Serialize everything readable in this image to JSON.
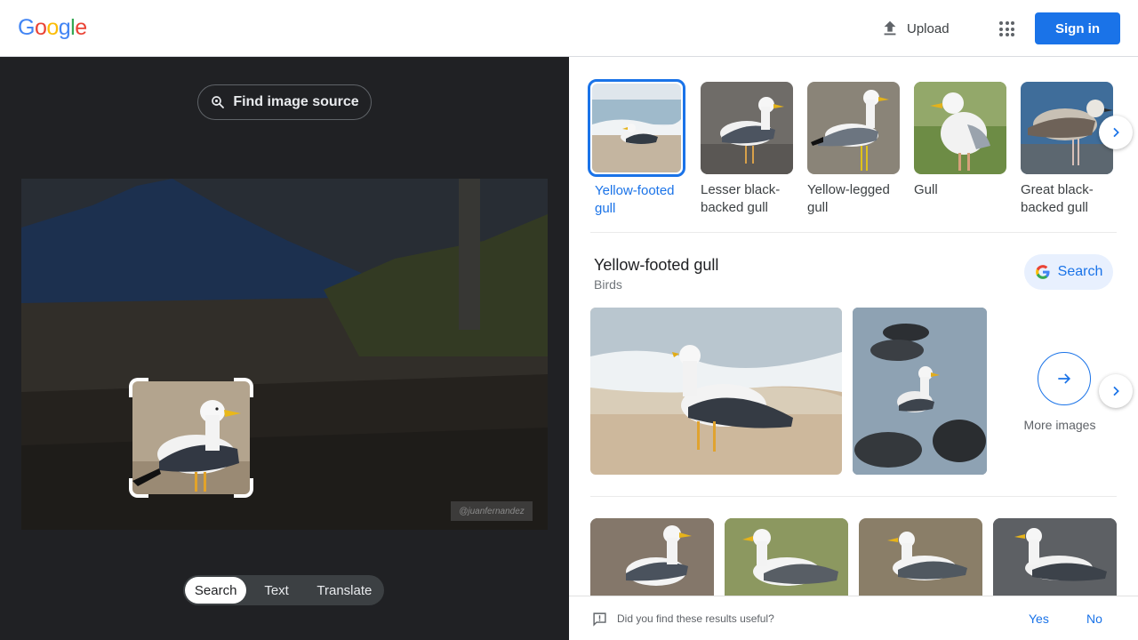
{
  "header": {
    "logo_letters": [
      {
        "ch": "G",
        "color": "#4285F4"
      },
      {
        "ch": "o",
        "color": "#EA4335"
      },
      {
        "ch": "o",
        "color": "#FBBC05"
      },
      {
        "ch": "g",
        "color": "#4285F4"
      },
      {
        "ch": "l",
        "color": "#34A853"
      },
      {
        "ch": "e",
        "color": "#EA4335"
      }
    ],
    "upload_label": "Upload",
    "apps_icon": "apps-grid-icon",
    "signin_label": "Sign in"
  },
  "left": {
    "find_source_label": "Find image source",
    "watermark": "@juanfernandez",
    "modes": [
      "Search",
      "Text",
      "Translate"
    ],
    "active_mode": "Search"
  },
  "results": {
    "thumbs": [
      {
        "label": "Yellow-footed gull",
        "selected": true
      },
      {
        "label": "Lesser black-backed gull",
        "selected": false
      },
      {
        "label": "Yellow-legged gull",
        "selected": false
      },
      {
        "label": "Gull",
        "selected": false
      },
      {
        "label": "Great black-backed gull",
        "selected": false
      }
    ],
    "knowledge": {
      "title": "Yellow-footed gull",
      "subtitle": "Birds",
      "search_label": "Search",
      "more_images_label": "More images"
    },
    "feedback": {
      "question": "Did you find these results useful?",
      "yes": "Yes",
      "no": "No"
    }
  },
  "colors": {
    "accent": "#1a73e8",
    "dark_panel": "#202124"
  }
}
